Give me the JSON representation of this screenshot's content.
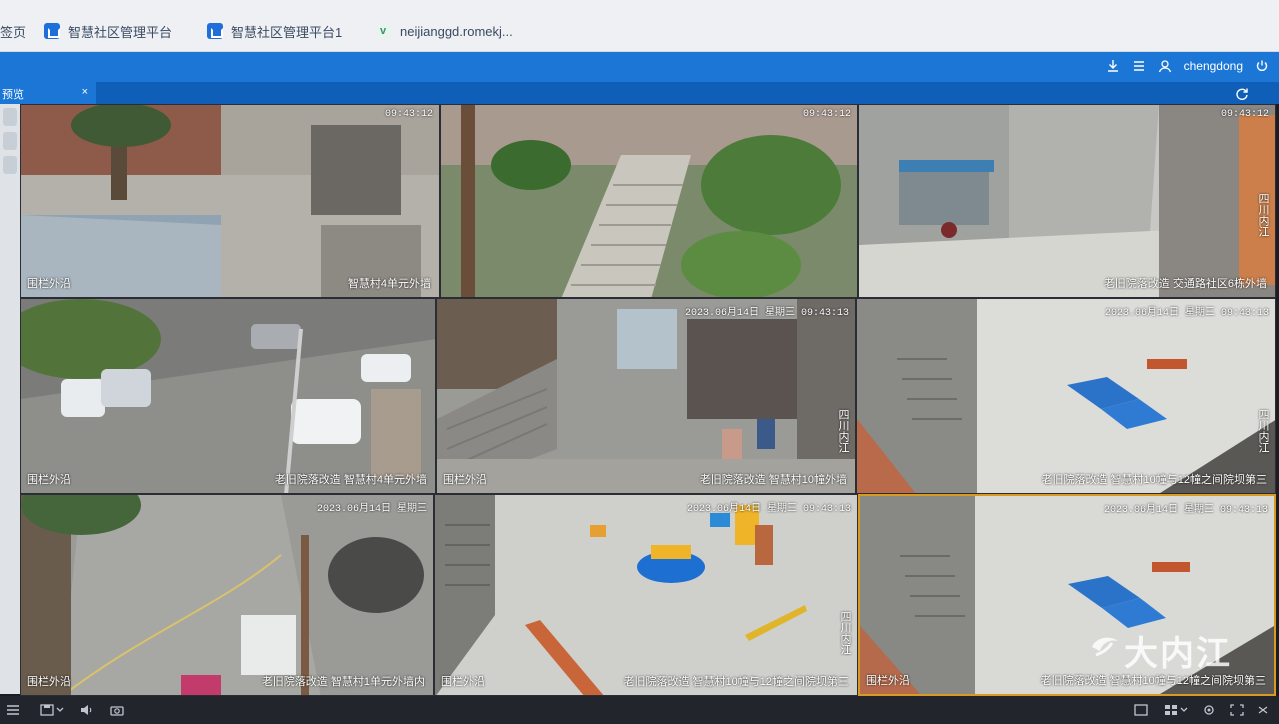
{
  "browser": {
    "bookmarks": [
      {
        "label": "签页",
        "icon": "none"
      },
      {
        "label": "智慧社区管理平台",
        "icon": "platform-icon"
      },
      {
        "label": "智慧社区管理平台1",
        "icon": "platform-icon"
      },
      {
        "label": "neijianggd.romekj...",
        "icon": "v-icon"
      }
    ]
  },
  "app": {
    "username": "chengdong",
    "tab_label": "预览",
    "tab_close": "×"
  },
  "cameras": [
    {
      "timestamp": "09:43:12",
      "channel": "围栏外沿",
      "caption": "智慧村4单元外墙"
    },
    {
      "timestamp": "09:43:12",
      "channel": "",
      "caption": ""
    },
    {
      "timestamp": "09:43:12",
      "channel": "",
      "caption_vertical": "四川内江",
      "caption": "老旧院落改造 交通路社区6栋外墙"
    },
    {
      "timestamp": "",
      "channel": "围栏外沿",
      "caption": "老旧院落改造 智慧村4单元外墙"
    },
    {
      "timestamp": "2023.06月14日 星期三 09:43:13",
      "channel": "围栏外沿",
      "caption_vertical": "四川内江",
      "caption": "老旧院落改造 智慧村10幢外墙"
    },
    {
      "timestamp": "2023.06月14日 星期三 09:43:13",
      "channel": "",
      "caption_vertical": "四川内江",
      "caption": "老旧院落改造 智慧村10幢与12幢之间院坝第三"
    },
    {
      "timestamp": "2023.06月14日 星期三",
      "channel": "围栏外沿",
      "caption": "老旧院落改造 智慧村1单元外墙内"
    },
    {
      "timestamp": "2023.06月14日 星期三 09:43:13",
      "channel": "围栏外沿",
      "caption_vertical": "四川内江",
      "caption": "老旧院落改造 智慧村10幢与12幢之间院坝第三"
    },
    {
      "timestamp": "2023.06月14日 星期三 09:43:13",
      "channel": "围栏外沿",
      "caption": "老旧院落改造 智慧村10幢与12幢之间院坝第三"
    }
  ],
  "watermark": "大内江",
  "colors": {
    "brand_blue": "#1b76d6",
    "dark_blue": "#0f5fb8",
    "selected_border": "#d99a24"
  }
}
